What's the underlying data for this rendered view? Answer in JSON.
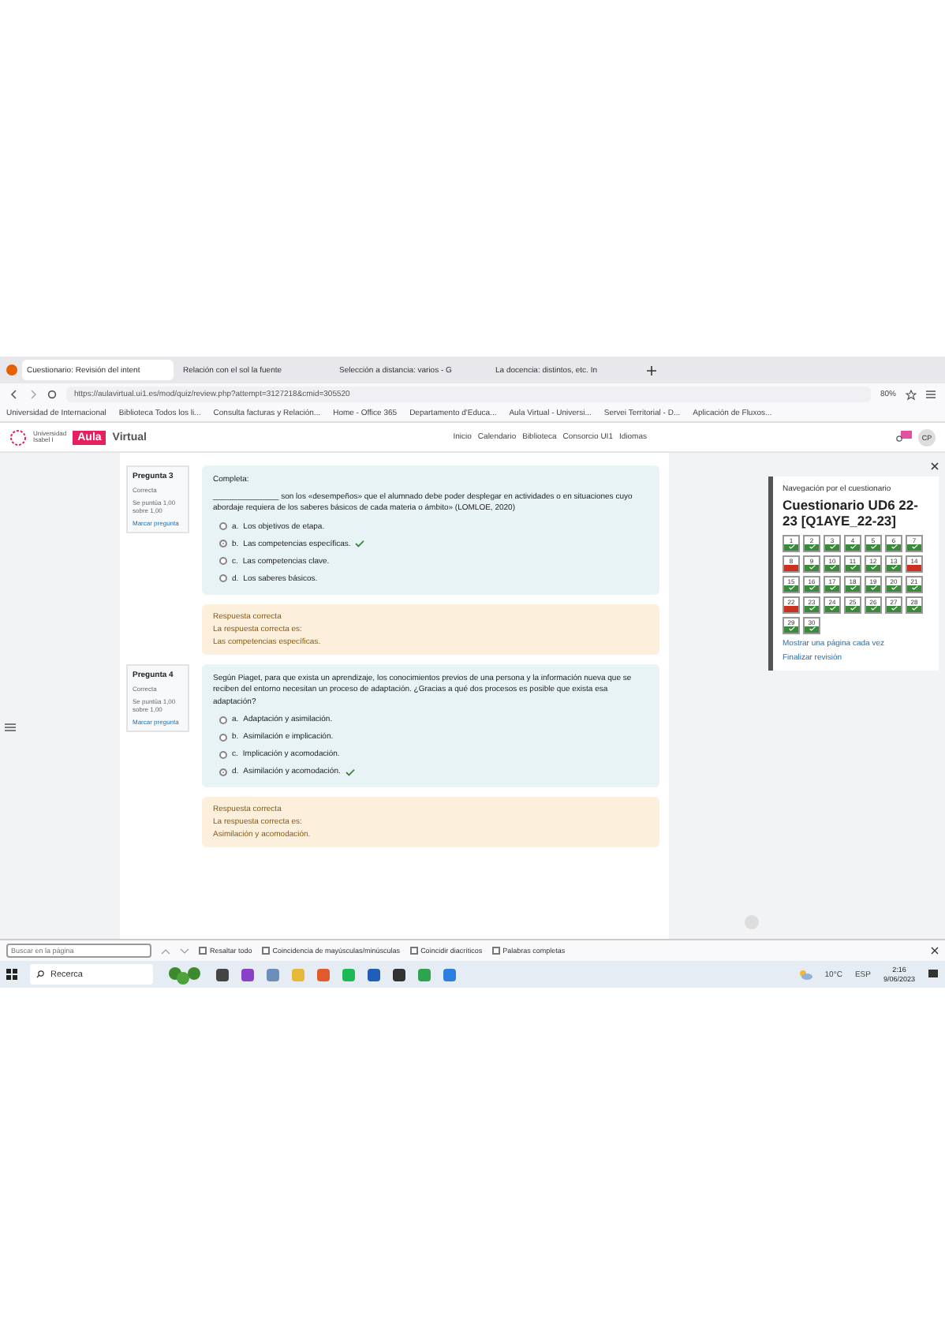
{
  "browser": {
    "tabs": [
      {
        "title": "Cuestionario: Revisión del intent",
        "selected": true
      },
      {
        "title": "Relación con el sol la fuente",
        "selected": false
      },
      {
        "title": "Selección a distancia: varios - G",
        "selected": false
      },
      {
        "title": "La docencia: distintos, etc. In",
        "selected": false
      }
    ],
    "url": "https://aulavirtual.ui1.es/mod/quiz/review.php?attempt=3127218&cmid=305520",
    "zoom": "80%",
    "bookmarks": [
      "Universidad de Internacional",
      "Biblioteca Todos los li...",
      "Consulta facturas y Relación...",
      "Home - Office 365",
      "Departamento d'Educa...",
      "Aula Virtual - Universi...",
      "Servei Territorial - D...",
      "Aplicación de Fluxos..."
    ]
  },
  "site": {
    "logo_top": "Universidad",
    "logo_bottom": "Isabel I",
    "brand_badge": "Aula",
    "brand_text": "Virtual",
    "nav": [
      "Inicio",
      "Calendario",
      "Biblioteca",
      "Consorcio UI1",
      "Idiomas"
    ],
    "avatar": "CP"
  },
  "questions": [
    {
      "label": "Pregunta 3",
      "status": "Correcta",
      "score": "Se puntúa 1,00 sobre 1,00",
      "flag": "Marcar pregunta",
      "prompt_title": "Completa:",
      "prompt": "_______________ son los «desempeños» que el alumnado debe poder desplegar en actividades o en situaciones cuyo abordaje requiera de los saberes básicos de cada materia o ámbito» (LOMLOE, 2020)",
      "options": [
        {
          "letter": "a.",
          "text": "Los objetivos de etapa.",
          "selected": false
        },
        {
          "letter": "b.",
          "text": "Las competencias específicas.",
          "selected": true
        },
        {
          "letter": "c.",
          "text": "Las competencias clave.",
          "selected": false
        },
        {
          "letter": "d.",
          "text": "Los saberes básicos.",
          "selected": false
        }
      ],
      "feedback": [
        "Respuesta correcta",
        "La respuesta correcta es:",
        "Las competencias específicas."
      ]
    },
    {
      "label": "Pregunta 4",
      "status": "Correcta",
      "score": "Se puntúa 1,00 sobre 1,00",
      "flag": "Marcar pregunta",
      "prompt": "Según Piaget, para que exista un aprendizaje, los conocimientos previos de una persona y la información nueva que se reciben del entorno necesitan un proceso de adaptación. ¿Gracias a qué dos procesos es posible que exista esa adaptación?",
      "options": [
        {
          "letter": "a.",
          "text": "Adaptación y asimilación.",
          "selected": false
        },
        {
          "letter": "b.",
          "text": "Asimilación e implicación.",
          "selected": false
        },
        {
          "letter": "c.",
          "text": "Implicación y acomodación.",
          "selected": false
        },
        {
          "letter": "d.",
          "text": "Asimilación y acomodación.",
          "selected": true
        }
      ],
      "feedback": [
        "Respuesta correcta",
        "La respuesta correcta es:",
        "Asimilación y acomodación."
      ]
    }
  ],
  "quiz_nav": {
    "heading": "Navegación por el cuestionario",
    "title": "Cuestionario UD6 22-23 [Q1AYE_22-23]",
    "items": [
      {
        "n": "1",
        "correct": true
      },
      {
        "n": "2",
        "correct": true
      },
      {
        "n": "3",
        "correct": true
      },
      {
        "n": "4",
        "correct": true
      },
      {
        "n": "5",
        "correct": true
      },
      {
        "n": "6",
        "correct": true
      },
      {
        "n": "7",
        "correct": true
      },
      {
        "n": "8",
        "correct": false
      },
      {
        "n": "9",
        "correct": true
      },
      {
        "n": "10",
        "correct": true
      },
      {
        "n": "11",
        "correct": true
      },
      {
        "n": "12",
        "correct": true
      },
      {
        "n": "13",
        "correct": true
      },
      {
        "n": "14",
        "correct": false
      },
      {
        "n": "15",
        "correct": true
      },
      {
        "n": "16",
        "correct": true
      },
      {
        "n": "17",
        "correct": true
      },
      {
        "n": "18",
        "correct": true
      },
      {
        "n": "19",
        "correct": true
      },
      {
        "n": "20",
        "correct": true
      },
      {
        "n": "21",
        "correct": true
      },
      {
        "n": "22",
        "correct": false
      },
      {
        "n": "23",
        "correct": true
      },
      {
        "n": "24",
        "correct": true
      },
      {
        "n": "25",
        "correct": true
      },
      {
        "n": "26",
        "correct": true
      },
      {
        "n": "27",
        "correct": true
      },
      {
        "n": "28",
        "correct": true
      },
      {
        "n": "29",
        "correct": true
      },
      {
        "n": "30",
        "correct": true
      }
    ],
    "links": [
      "Mostrar una página cada vez",
      "Finalizar revisión"
    ]
  },
  "find_bar": {
    "placeholder": "Buscar en la página",
    "options": [
      {
        "label": "Resaltar todo",
        "checked": false
      },
      {
        "label": "Coincidencia de mayúsculas/minúsculas",
        "checked": false
      },
      {
        "label": "Coincidir diacríticos",
        "checked": false
      },
      {
        "label": "Palabras completas",
        "checked": false
      }
    ]
  },
  "taskbar": {
    "search": "Recerca",
    "weather": "10°C",
    "lang": "ESP",
    "time": "2:16",
    "date": "9/06/2023"
  }
}
